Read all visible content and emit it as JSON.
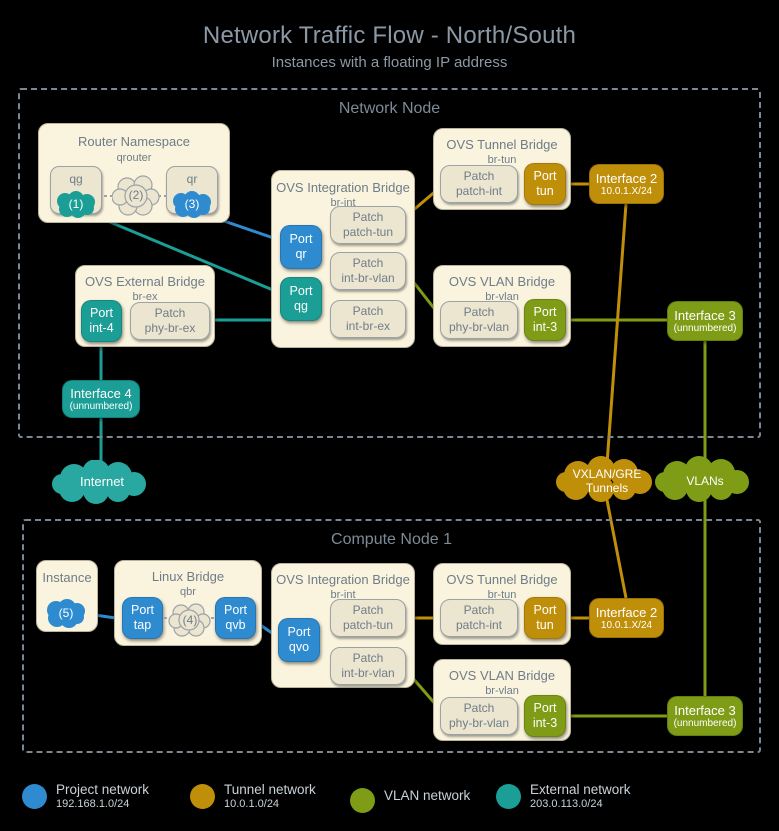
{
  "title": {
    "main": "Network Traffic Flow - North/South",
    "subtitle": "Instances with a floating IP address"
  },
  "colors": {
    "project_network": "#2e8bd0",
    "tunnel_network": "#c08f0a",
    "vlan_network": "#7e9c15",
    "external_network": "#1a9e96",
    "panel_bg": "#faf3dd",
    "node_border": "#7b8792"
  },
  "network_node": {
    "label": "Network Node",
    "router_namespace": {
      "title": "Router Namespace",
      "subtitle": "qrouter",
      "qg": {
        "label": "qg",
        "step": "(1)"
      },
      "middle_cloud": {
        "step": "(2)"
      },
      "qr": {
        "label": "qr",
        "step": "(3)"
      }
    },
    "br_int": {
      "title": "OVS Integration Bridge",
      "subtitle": "br-int",
      "ports": [
        {
          "line1": "Port",
          "line2": "qr"
        },
        {
          "line1": "Port",
          "line2": "qg"
        }
      ],
      "patches": [
        {
          "line1": "Patch",
          "line2": "patch-tun"
        },
        {
          "line1": "Patch",
          "line2": "int-br-vlan"
        },
        {
          "line1": "Patch",
          "line2": "int-br-ex"
        }
      ]
    },
    "br_tun": {
      "title": "OVS Tunnel Bridge",
      "subtitle": "br-tun",
      "patch": {
        "line1": "Patch",
        "line2": "patch-int"
      },
      "port": {
        "line1": "Port",
        "line2": "tun"
      }
    },
    "br_vlan": {
      "title": "OVS VLAN Bridge",
      "subtitle": "br-vlan",
      "patch": {
        "line1": "Patch",
        "line2": "phy-br-vlan"
      },
      "port": {
        "line1": "Port",
        "line2": "int-3"
      }
    },
    "br_ex": {
      "title": "OVS External Bridge",
      "subtitle": "br-ex",
      "port": {
        "line1": "Port",
        "line2": "int-4"
      },
      "patch": {
        "line1": "Patch",
        "line2": "phy-br-ex"
      }
    },
    "interface2": {
      "name": "Interface 2",
      "detail": "10.0.1.X/24"
    },
    "interface3": {
      "name": "Interface 3",
      "detail": "(unnumbered)"
    },
    "interface4": {
      "name": "Interface 4",
      "detail": "(unnumbered)"
    }
  },
  "internet_cloud": {
    "label": "Internet"
  },
  "tunnel_cloud": {
    "line1": "VXLAN/GRE",
    "line2": "Tunnels"
  },
  "vlan_cloud": {
    "label": "VLANs"
  },
  "compute_node": {
    "label": "Compute Node 1",
    "instance": {
      "title": "Instance",
      "step": "(5)"
    },
    "linux_bridge": {
      "title": "Linux Bridge",
      "subtitle": "qbr",
      "port_tap": {
        "line1": "Port",
        "line2": "tap"
      },
      "middle_cloud": {
        "step": "(4)"
      },
      "port_qvb": {
        "line1": "Port",
        "line2": "qvb"
      }
    },
    "br_int": {
      "title": "OVS Integration Bridge",
      "subtitle": "br-int",
      "port": {
        "line1": "Port",
        "line2": "qvo"
      },
      "patches": [
        {
          "line1": "Patch",
          "line2": "patch-tun"
        },
        {
          "line1": "Patch",
          "line2": "int-br-vlan"
        }
      ]
    },
    "br_tun": {
      "title": "OVS Tunnel Bridge",
      "subtitle": "br-tun",
      "patch": {
        "line1": "Patch",
        "line2": "patch-int"
      },
      "port": {
        "line1": "Port",
        "line2": "tun"
      }
    },
    "br_vlan": {
      "title": "OVS VLAN Bridge",
      "subtitle": "br-vlan",
      "patch": {
        "line1": "Patch",
        "line2": "phy-br-vlan"
      },
      "port": {
        "line1": "Port",
        "line2": "int-3"
      }
    },
    "interface2": {
      "name": "Interface 2",
      "detail": "10.0.1.X/24"
    },
    "interface3": {
      "name": "Interface 3",
      "detail": "(unnumbered)"
    }
  },
  "legend": [
    {
      "name": "Project network",
      "subnet": "192.168.1.0/24",
      "color": "#2e8bd0"
    },
    {
      "name": "Tunnel network",
      "subnet": "10.0.1.0/24",
      "color": "#c08f0a"
    },
    {
      "name": "VLAN network",
      "subnet": "",
      "color": "#7e9c15"
    },
    {
      "name": "External network",
      "subnet": "203.0.113.0/24",
      "color": "#1a9e96"
    }
  ]
}
